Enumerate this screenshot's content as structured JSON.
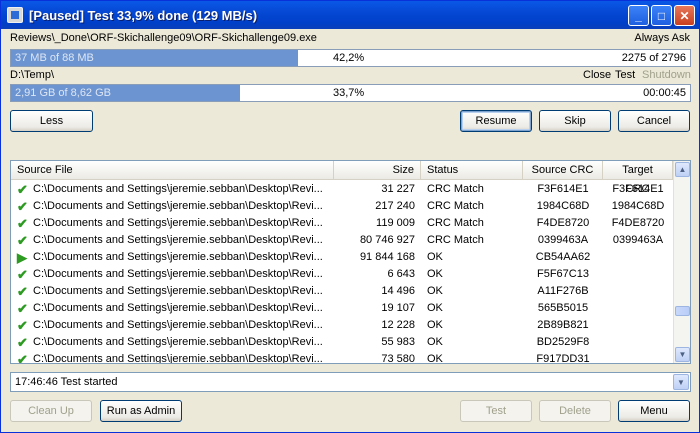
{
  "window": {
    "title": "[Paused] Test 33,9% done (129 MB/s)",
    "minimize": "_",
    "maximize": "□",
    "close": "✕"
  },
  "file": {
    "path": "Reviews\\_Done\\ORF-Skichallenge09\\ORF-Skichallenge09.exe",
    "action": "Always Ask",
    "size_text": "37 MB of 88 MB",
    "percent": "42,2%",
    "progress": 0.422,
    "count": "2275 of 2796"
  },
  "total": {
    "path": "D:\\Temp\\",
    "opt_close": "Close",
    "opt_test": "Test",
    "opt_shutdown": "Shutdown",
    "size_text": "2,91 GB of 8,62 GB",
    "percent": "33,7%",
    "progress": 0.337,
    "time": "00:00:45"
  },
  "buttons": {
    "less": "Less",
    "resume": "Resume",
    "skip": "Skip",
    "cancel": "Cancel",
    "clean_up": "Clean Up",
    "run_as_admin": "Run as Admin",
    "test": "Test",
    "delete": "Delete",
    "menu": "Menu"
  },
  "columns": {
    "source": "Source File",
    "size": "Size",
    "status": "Status",
    "source_crc": "Source CRC",
    "target_crc": "Target CRC"
  },
  "rows": [
    {
      "icon": "check-plus",
      "file": "C:\\Documents and Settings\\jeremie.sebban\\Desktop\\Revi...",
      "size": "31 227",
      "status": "CRC Match",
      "scrc": "F3F614E1",
      "tcrc": "F3F614E1"
    },
    {
      "icon": "check-plus",
      "file": "C:\\Documents and Settings\\jeremie.sebban\\Desktop\\Revi...",
      "size": "217 240",
      "status": "CRC Match",
      "scrc": "1984C68D",
      "tcrc": "1984C68D"
    },
    {
      "icon": "check-plus",
      "file": "C:\\Documents and Settings\\jeremie.sebban\\Desktop\\Revi...",
      "size": "119 009",
      "status": "CRC Match",
      "scrc": "F4DE8720",
      "tcrc": "F4DE8720"
    },
    {
      "icon": "check-plus",
      "file": "C:\\Documents and Settings\\jeremie.sebban\\Desktop\\Revi...",
      "size": "80 746 927",
      "status": "CRC Match",
      "scrc": "0399463A",
      "tcrc": "0399463A"
    },
    {
      "icon": "play",
      "file": "C:\\Documents and Settings\\jeremie.sebban\\Desktop\\Revi...",
      "size": "91 844 168",
      "status": "OK",
      "scrc": "CB54AA62",
      "tcrc": ""
    },
    {
      "icon": "check",
      "file": "C:\\Documents and Settings\\jeremie.sebban\\Desktop\\Revi...",
      "size": "6 643",
      "status": "OK",
      "scrc": "F5F67C13",
      "tcrc": ""
    },
    {
      "icon": "check",
      "file": "C:\\Documents and Settings\\jeremie.sebban\\Desktop\\Revi...",
      "size": "14 496",
      "status": "OK",
      "scrc": "A11F276B",
      "tcrc": ""
    },
    {
      "icon": "check",
      "file": "C:\\Documents and Settings\\jeremie.sebban\\Desktop\\Revi...",
      "size": "19 107",
      "status": "OK",
      "scrc": "565B5015",
      "tcrc": ""
    },
    {
      "icon": "check",
      "file": "C:\\Documents and Settings\\jeremie.sebban\\Desktop\\Revi...",
      "size": "12 228",
      "status": "OK",
      "scrc": "2B89B821",
      "tcrc": ""
    },
    {
      "icon": "check",
      "file": "C:\\Documents and Settings\\jeremie.sebban\\Desktop\\Revi...",
      "size": "55 983",
      "status": "OK",
      "scrc": "BD2529F8",
      "tcrc": ""
    },
    {
      "icon": "check",
      "file": "C:\\Documents and Settings\\jeremie.sebban\\Desktop\\Revi...",
      "size": "73 580",
      "status": "OK",
      "scrc": "F917DD31",
      "tcrc": ""
    }
  ],
  "log": {
    "text": "17:46:46 Test started"
  }
}
